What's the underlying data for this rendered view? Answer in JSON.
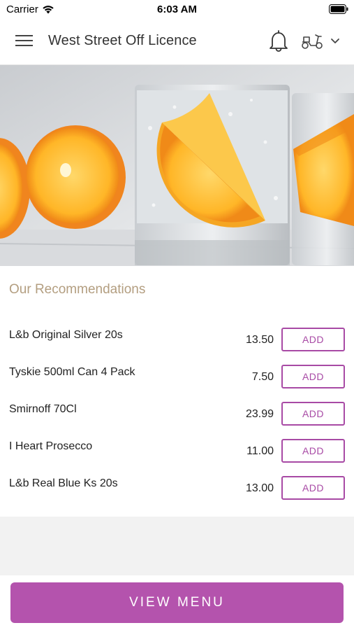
{
  "status_bar": {
    "carrier": "Carrier",
    "time": "6:03 AM"
  },
  "nav": {
    "title": "West Street Off Licence",
    "icons": [
      "hamburger-menu-icon",
      "bell-icon",
      "scooter-icon",
      "chevron-down-icon"
    ]
  },
  "recommendations": {
    "title": "Our Recommendations",
    "items": [
      {
        "name": "L&b Original Silver 20s",
        "price": "13.50",
        "button": "ADD"
      },
      {
        "name": "Tyskie 500ml Can 4 Pack",
        "price": "7.50",
        "button": "ADD"
      },
      {
        "name": "Smirnoff 70Cl",
        "price": "23.99",
        "button": "ADD"
      },
      {
        "name": "I Heart Prosecco",
        "price": "11.00",
        "button": "ADD"
      },
      {
        "name": "L&b Real Blue Ks 20s",
        "price": "13.00",
        "button": "ADD"
      }
    ]
  },
  "footer": {
    "view_menu_label": "VIEW MENU"
  },
  "colors": {
    "accent": "#b453ad",
    "section_title": "#b39e80"
  }
}
